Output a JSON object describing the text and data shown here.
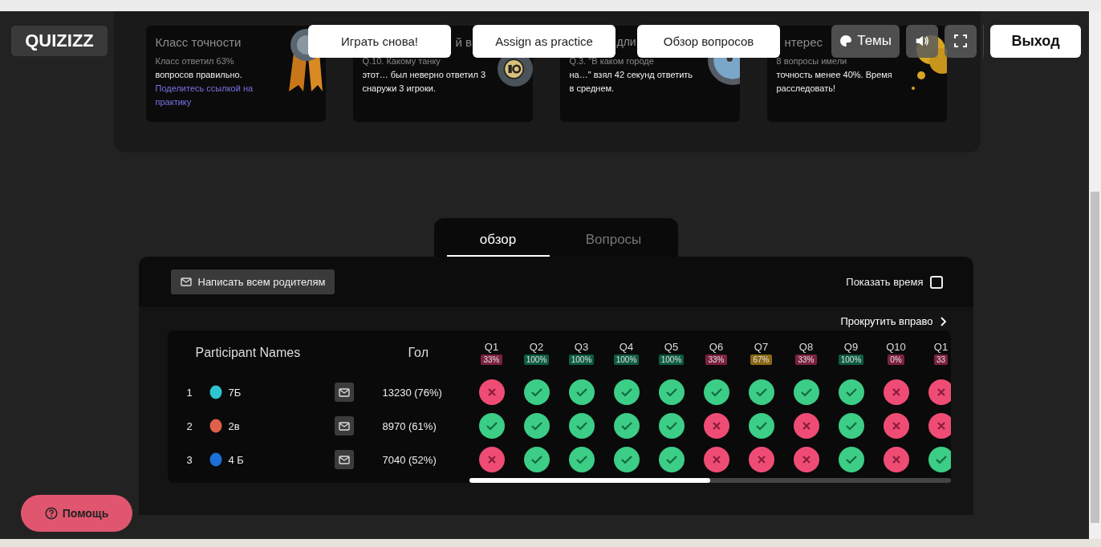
{
  "header": {
    "logo": "QUIZIZZ",
    "buttons": [
      {
        "label": "Играть снова!"
      },
      {
        "label": "Assign as practice"
      },
      {
        "label": "Обзор вопросов"
      }
    ],
    "theme_button": "Темы",
    "exit_button": "Выход"
  },
  "cards": [
    {
      "title": "Класс точности",
      "lead": "Класс ответил 63%",
      "body": "вопросов правильно.",
      "link": "Поделитесь ссылкой на практику",
      "kind": "medal"
    },
    {
      "title": "й в",
      "lead": "Q.10. Какому танку",
      "body": "этот… был неверно ответил 3 снаружи 3 игроки.",
      "kind": "ball"
    },
    {
      "title": "дли",
      "lead": "Q.3. \"В каком городе",
      "body": "на…\" взял 42 секунд ответить в среднем.",
      "kind": "gauge"
    },
    {
      "title": "нтерес",
      "lead": "8 вопросы имели",
      "body": "точность менее 40%. Время расследовать!",
      "kind": "cloud"
    }
  ],
  "tabs": [
    {
      "label": "обзор",
      "selected": true
    },
    {
      "label": "Вопросы",
      "selected": false
    }
  ],
  "toolbar": {
    "email_all": "Написать всем родителям",
    "show_time": {
      "label": "Показать время",
      "checked": false
    }
  },
  "scroll_right": "Прокрутить вправо",
  "table": {
    "name_header": "Participant Names",
    "score_header": "Гол",
    "questions": [
      {
        "label": "Q1",
        "accuracy": "33%",
        "color": "#7c2140"
      },
      {
        "label": "Q2",
        "accuracy": "100%",
        "color": "#0d5c40"
      },
      {
        "label": "Q3",
        "accuracy": "100%",
        "color": "#0d5c40"
      },
      {
        "label": "Q4",
        "accuracy": "100%",
        "color": "#0d5c40"
      },
      {
        "label": "Q5",
        "accuracy": "100%",
        "color": "#0d5c40"
      },
      {
        "label": "Q6",
        "accuracy": "33%",
        "color": "#7c2140"
      },
      {
        "label": "Q7",
        "accuracy": "67%",
        "color": "#8a6814"
      },
      {
        "label": "Q8",
        "accuracy": "33%",
        "color": "#7c2140"
      },
      {
        "label": "Q9",
        "accuracy": "100%",
        "color": "#0d5c40"
      },
      {
        "label": "Q10",
        "accuracy": "0%",
        "color": "#7c2140"
      },
      {
        "label": "Q1",
        "accuracy": "33",
        "color": "#7c2140"
      }
    ],
    "rows": [
      {
        "rank": "1",
        "name": "7Б",
        "color": "#2ec4d0",
        "score": "13230 (76%)",
        "answers": [
          false,
          true,
          true,
          true,
          true,
          true,
          true,
          true,
          true,
          false,
          false
        ]
      },
      {
        "rank": "2",
        "name": "2в",
        "color": "#e0604a",
        "score": "8970 (61%)",
        "answers": [
          true,
          true,
          true,
          true,
          true,
          false,
          true,
          false,
          true,
          false,
          false
        ]
      },
      {
        "rank": "3",
        "name": "4 Б",
        "color": "#1e6fd8",
        "score": "7040 (52%)",
        "answers": [
          false,
          true,
          true,
          true,
          true,
          false,
          false,
          false,
          true,
          false,
          true
        ]
      }
    ]
  },
  "help_button": "Помощь"
}
